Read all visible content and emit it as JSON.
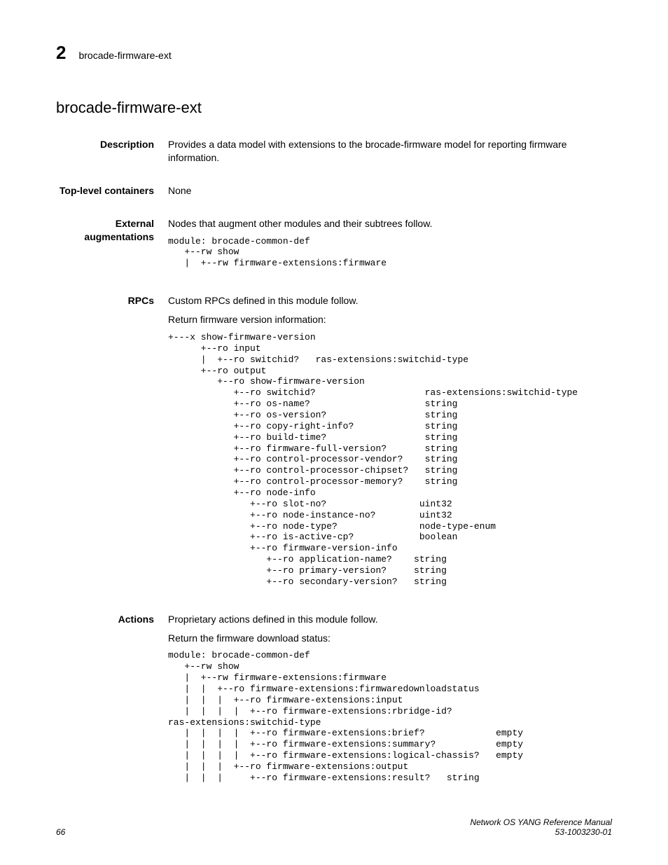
{
  "header": {
    "chapter": "2",
    "running": "brocade-firmware-ext"
  },
  "title": "brocade-firmware-ext",
  "description": {
    "label": "Description",
    "text": "Provides a data model with extensions to the brocade-firmware model for reporting firmware information."
  },
  "containers": {
    "label": "Top-level containers",
    "text": "None"
  },
  "augmentations": {
    "label": "External augmentations",
    "intro": "Nodes that augment other modules and their subtrees follow.",
    "code": "module: brocade-common-def\n   +--rw show\n   |  +--rw firmware-extensions:firmware"
  },
  "rpcs": {
    "label": "RPCs",
    "intro": "Custom RPCs defined in this module follow.",
    "sub": "Return firmware version information:",
    "code": "+---x show-firmware-version\n      +--ro input\n      |  +--ro switchid?   ras-extensions:switchid-type\n      +--ro output\n         +--ro show-firmware-version\n            +--ro switchid?                    ras-extensions:switchid-type\n            +--ro os-name?                     string\n            +--ro os-version?                  string\n            +--ro copy-right-info?             string\n            +--ro build-time?                  string\n            +--ro firmware-full-version?       string\n            +--ro control-processor-vendor?    string\n            +--ro control-processor-chipset?   string\n            +--ro control-processor-memory?    string\n            +--ro node-info\n               +--ro slot-no?                 uint32\n               +--ro node-instance-no?        uint32\n               +--ro node-type?               node-type-enum\n               +--ro is-active-cp?            boolean\n               +--ro firmware-version-info\n                  +--ro application-name?    string\n                  +--ro primary-version?     string\n                  +--ro secondary-version?   string"
  },
  "actions": {
    "label": "Actions",
    "intro": "Proprietary actions defined in this module follow.",
    "sub": "Return the firmware download status:",
    "code": "module: brocade-common-def\n   +--rw show\n   |  +--rw firmware-extensions:firmware\n   |  |  +--ro firmware-extensions:firmwaredownloadstatus\n   |  |  |  +--ro firmware-extensions:input\n   |  |  |  |  +--ro firmware-extensions:rbridge-id?\nras-extensions:switchid-type\n   |  |  |  |  +--ro firmware-extensions:brief?             empty\n   |  |  |  |  +--ro firmware-extensions:summary?           empty\n   |  |  |  |  +--ro firmware-extensions:logical-chassis?   empty\n   |  |  |  +--ro firmware-extensions:output\n   |  |  |     +--ro firmware-extensions:result?   string"
  },
  "footer": {
    "page": "66",
    "manual": "Network OS YANG Reference Manual",
    "docnum": "53-1003230-01"
  }
}
